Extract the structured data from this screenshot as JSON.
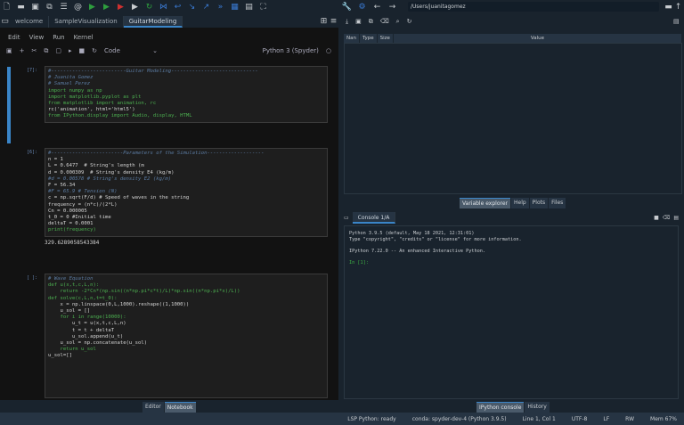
{
  "toolbar": {
    "icons": [
      "new-file",
      "open-folder",
      "save",
      "save-all",
      "list",
      "at",
      "run",
      "run-cell",
      "run-cell-advance",
      "run-selection",
      "rerun",
      "debug",
      "step",
      "step-into",
      "step-out",
      "continue",
      "stop",
      "maximize",
      "expand"
    ]
  },
  "tabs": [
    {
      "label": "welcome"
    },
    {
      "label": "SampleVisualization"
    },
    {
      "label": "GuitarModeling",
      "active": true
    }
  ],
  "menu": [
    "Edit",
    "View",
    "Run",
    "Kernel"
  ],
  "nb_toolbar": {
    "cell_type": "Code",
    "kernel": "Python 3 (Spyder)"
  },
  "cells": [
    {
      "prompt": "[7]:",
      "lines": [
        "#-------------------------Guitar Modeling-----------------------------",
        "# Juanita Gomez",
        "# Samuel Perez",
        "",
        "import numpy as np",
        "import matplotlib.pyplot as plt",
        "from matplotlib import animation, rc",
        "rc('animation', html='html5')",
        "from IPython.display import Audio, display, HTML"
      ]
    },
    {
      "prompt": "[6]:",
      "lines": [
        "#------------------------Parameters of the Simulation-------------------",
        "n = 1",
        "L = 0.6477  # String's length (m",
        "d = 0.000309  # String's density E4 (kg/m)",
        "#d = 0.00578 # String's density E2 (kg/m)",
        "F = 56.34",
        "#F = 65.9 # Tension (N)",
        "c = np.sqrt(F/d) # Speed of waves in the string",
        "frequency = (n*c)/(2*L)",
        "Cn = 0.000005",
        "t_0 = 0 #Initial time",
        "deltaT = 0.0001",
        "print(frequency)"
      ],
      "output": "329.6289058543384"
    },
    {
      "prompt": "[ ]:",
      "lines": [
        "# Wave Equation",
        "def u(x,t,c,L,n):",
        "    return -2*Cn*(np.sin((n*np.pi*c*t)/L)*np.sin((n*np.pi*x)/L))",
        "",
        "def solve(c,L,n,t=t_0):",
        "    x = np.linspace(0,L,1000).reshape((1,1000))",
        "    u_sol = []",
        "    for i in range(10000):",
        "        u_t = u(x,t,c,L,n)",
        "        t = t + deltaT",
        "        u_sol.append(u_t)",
        "    u_sol = np.concatenate(u_sol)",
        "    return u_sol",
        "",
        "u_sol=[]"
      ]
    }
  ],
  "left_bottom_tabs": [
    {
      "label": "Editor"
    },
    {
      "label": "Notebook",
      "active": true
    }
  ],
  "path": "/Users/juanitagomez",
  "variable_explorer": {
    "columns": [
      "Nan",
      "Type",
      "Size",
      "Value"
    ]
  },
  "right_top_tabs": [
    {
      "label": "Variable explorer",
      "active": true
    },
    {
      "label": "Help"
    },
    {
      "label": "Plots"
    },
    {
      "label": "Files"
    }
  ],
  "console": {
    "tab": "Console 1/A",
    "lines": [
      "Python 3.9.5 (default, May 18 2021, 12:31:01)",
      "Type \"copyright\", \"credits\" or \"license\" for more information.",
      "",
      "IPython 7.22.0 -- An enhanced Interactive Python.",
      ""
    ],
    "prompt": "In [1]:"
  },
  "right_bottom_tabs": [
    {
      "label": "IPython console",
      "active": true
    },
    {
      "label": "History"
    }
  ],
  "status": {
    "lsp": "LSP Python: ready",
    "conda": "conda: spyder-dev-4 (Python 3.9.5)",
    "position": "Line 1, Col 1",
    "encoding": "UTF-8",
    "eol": "LF",
    "mode": "RW",
    "mem": "Mem 67%"
  }
}
